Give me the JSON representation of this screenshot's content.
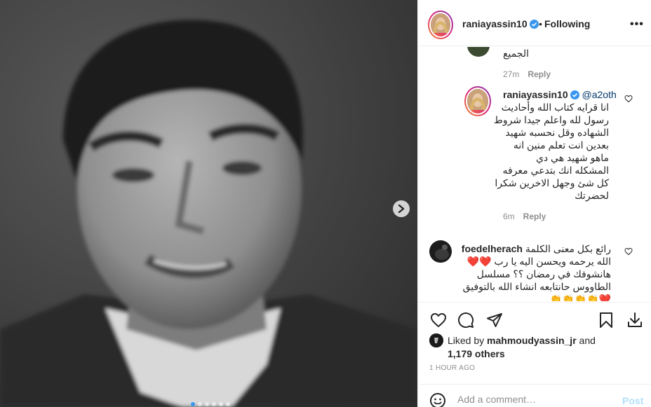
{
  "post_header": {
    "username": "raniayassin10",
    "separator": "•",
    "follow_status": "Following",
    "more_label": "•••"
  },
  "comments": [
    {
      "text": "الجميع",
      "age": "27m",
      "reply_label": "Reply"
    },
    {
      "username": "raniayassin10",
      "mention": "@a2oth",
      "lines": [
        "انا قرايه كتاب الله وأحاديث",
        "رسول لله واعلم جيدا شروط",
        "الشهاده وقل نحسبه شهيد",
        "بعدين انت تعلم منين انه",
        "ماهو شهيد هي دي",
        "المشكله انك بتدعي معرفه",
        "كل شئ وجهل الاخرين شكرا",
        "لحضرتك"
      ],
      "age": "6m",
      "reply_label": "Reply"
    },
    {
      "username": "foedelherach",
      "lines": [
        "رائع بكل معنى الكلمة",
        "الله يرحمه ويحسن اليه يا رب ❤️❤️",
        "هانشوفك في رمضان ؟؟ مسلسل",
        "الطاووس حانتابعه انشاء الله بالتوفيق",
        "❤️👏👏👏👏"
      ]
    }
  ],
  "likes": {
    "prefix": "Liked by",
    "user": "mahmoudyassin_jr",
    "and": "and",
    "others": "1,179 others"
  },
  "timestamp": "1 HOUR AGO",
  "add_comment": {
    "placeholder": "Add a comment…",
    "post_label": "Post"
  },
  "carousel": {
    "total": 6,
    "active_index": 0
  },
  "colors": {
    "accent_blue": "#3897f0",
    "post_disabled": "#b2dffc",
    "heart_red": "#ed4956",
    "meta_gray": "#8e8e8e"
  },
  "icons": [
    "heart-icon",
    "comment-icon",
    "share-icon",
    "save-icon",
    "download-icon",
    "emoji-icon",
    "chevron-right-icon",
    "verified-icon"
  ]
}
